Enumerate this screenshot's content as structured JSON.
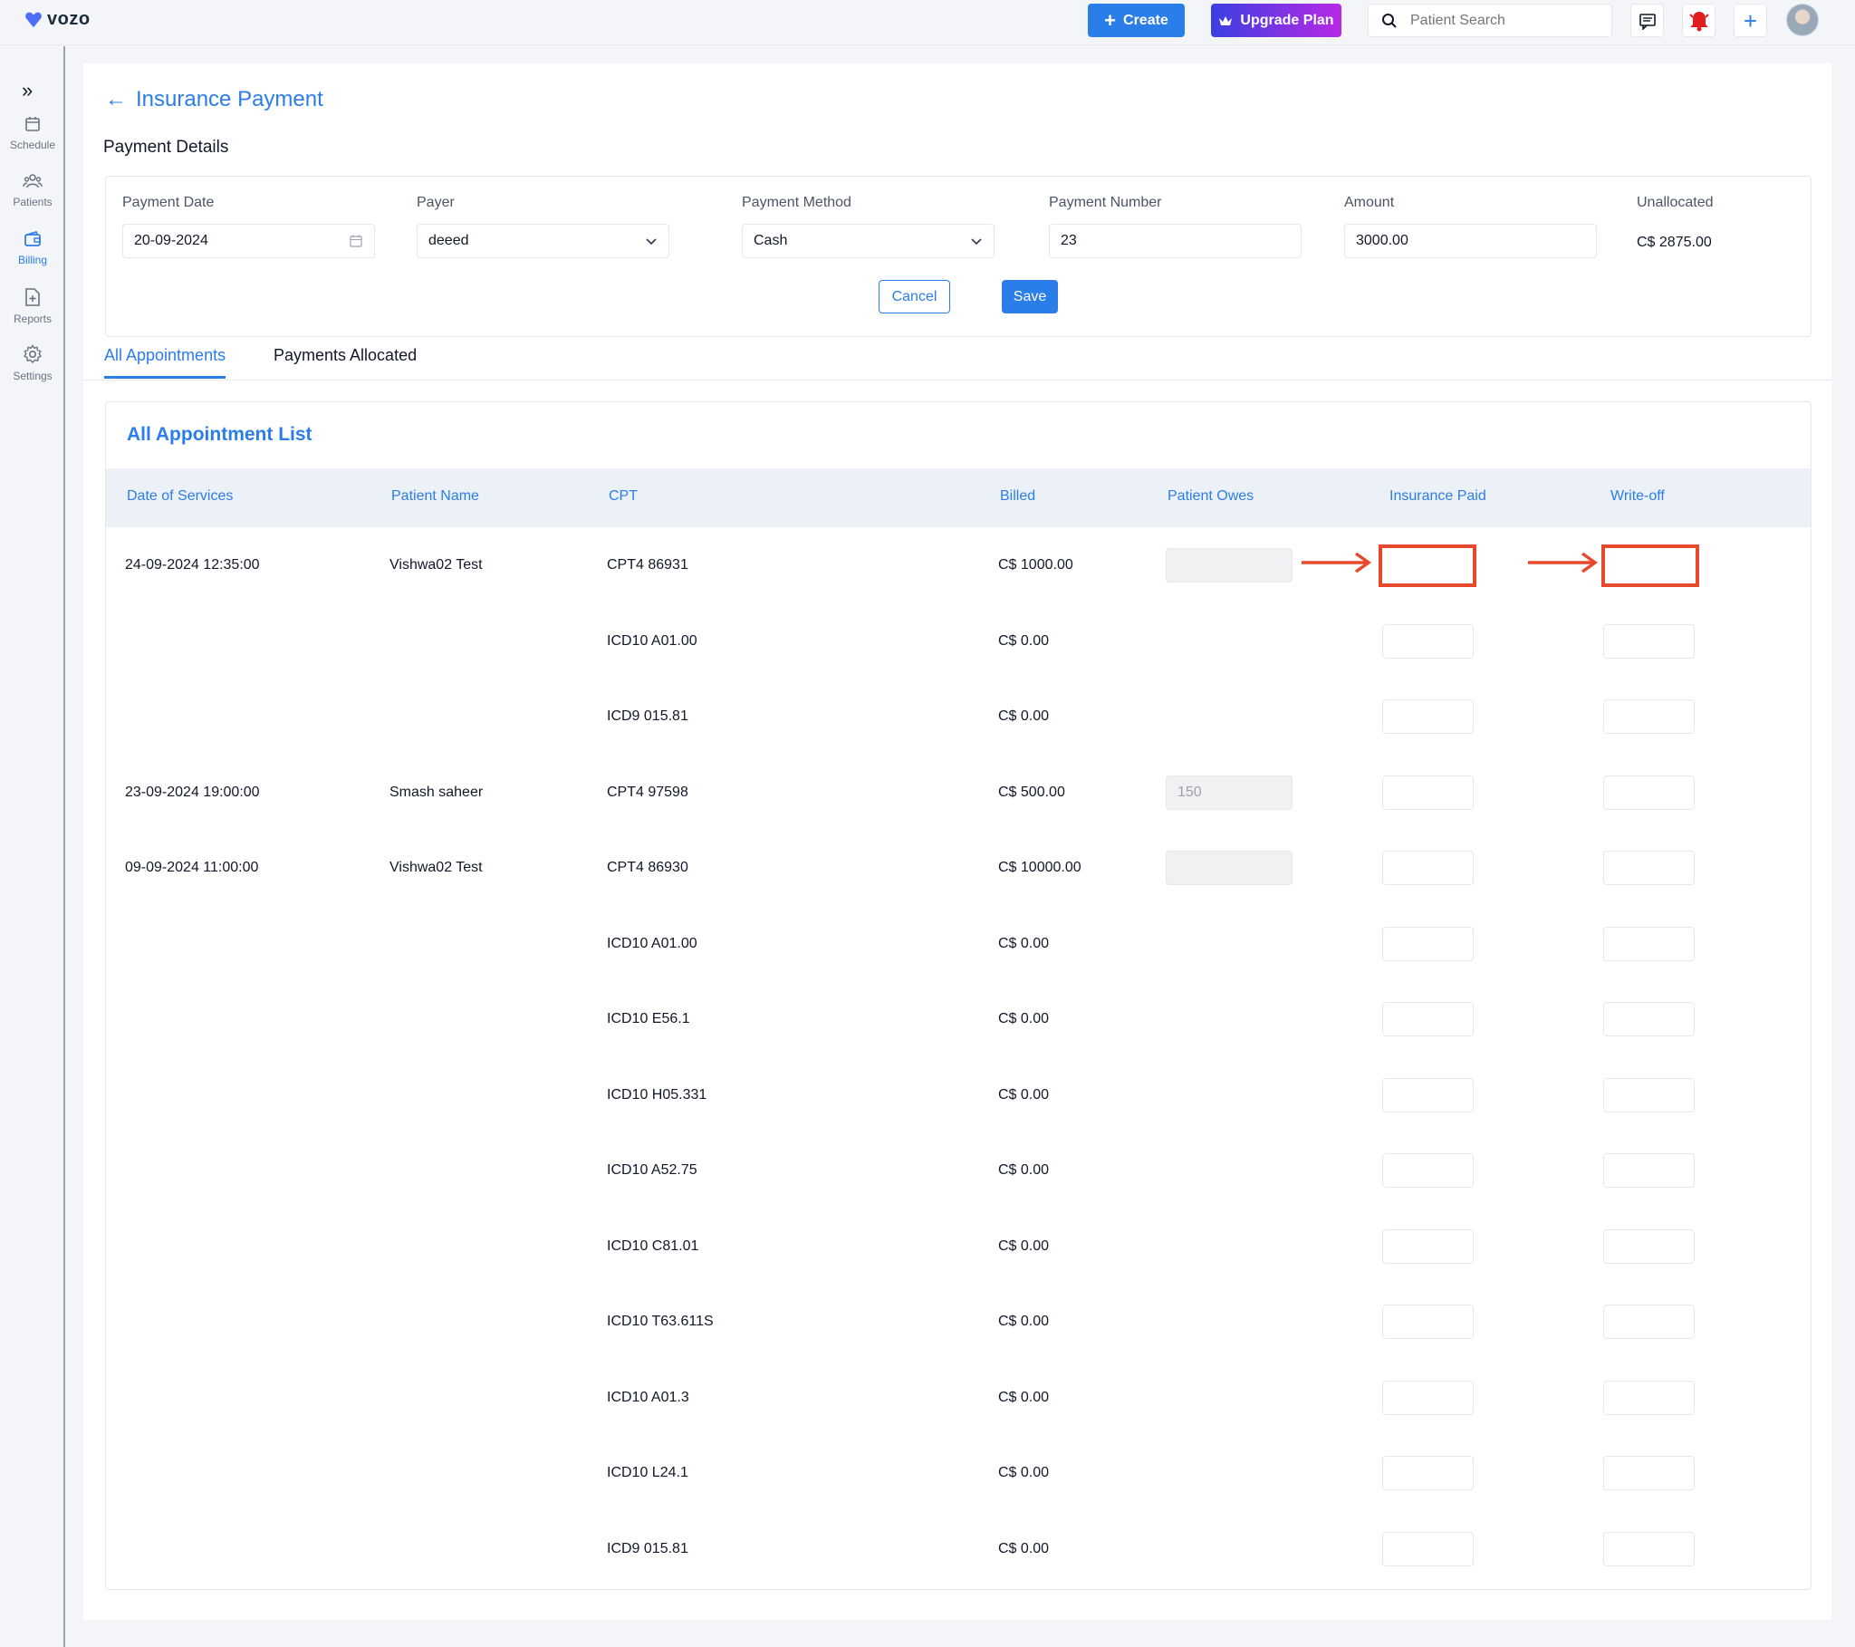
{
  "app": {
    "logo_text": "vozo"
  },
  "topbar": {
    "create_label": "Create",
    "upgrade_label": "Upgrade Plan",
    "search_placeholder": "Patient Search",
    "icons": [
      "chat-icon",
      "bell-icon",
      "plus-icon"
    ]
  },
  "sidebar": {
    "items": [
      {
        "label": "Schedule",
        "icon": "calendar-icon",
        "active": false
      },
      {
        "label": "Patients",
        "icon": "users-icon",
        "active": false
      },
      {
        "label": "Billing",
        "icon": "wallet-icon",
        "active": true
      },
      {
        "label": "Reports",
        "icon": "report-icon",
        "active": false
      },
      {
        "label": "Settings",
        "icon": "gear-icon",
        "active": false
      }
    ]
  },
  "page": {
    "title": "Insurance Payment",
    "section_title": "Payment Details"
  },
  "payment": {
    "date_label": "Payment Date",
    "date_value": "20-09-2024",
    "payer_label": "Payer",
    "payer_value": "deeed",
    "method_label": "Payment Method",
    "method_value": "Cash",
    "number_label": "Payment Number",
    "number_value": "23",
    "amount_label": "Amount",
    "amount_value": "3000.00",
    "unallocated_label": "Unallocated",
    "unallocated_value": "C$ 2875.00",
    "cancel_label": "Cancel",
    "save_label": "Save"
  },
  "tabs": [
    {
      "label": "All Appointments",
      "active": true
    },
    {
      "label": "Payments Allocated",
      "active": false
    }
  ],
  "list": {
    "title": "All Appointment List",
    "columns": [
      "Date of Services",
      "Patient Name",
      "CPT",
      "Billed",
      "Patient Owes",
      "Insurance Paid",
      "Write-off"
    ],
    "rows": [
      {
        "date": "24-09-2024 12:35:00",
        "patient": "Vishwa02 Test",
        "cpt": "CPT4 86931",
        "billed": "C$ 1000.00",
        "owes": "",
        "show_owes": true,
        "highlight": true
      },
      {
        "date": "",
        "patient": "",
        "cpt": "ICD10 A01.00",
        "billed": "C$ 0.00",
        "owes": "",
        "show_owes": false,
        "highlight": false
      },
      {
        "date": "",
        "patient": "",
        "cpt": "ICD9 015.81",
        "billed": "C$ 0.00",
        "owes": "",
        "show_owes": false,
        "highlight": false
      },
      {
        "date": "23-09-2024 19:00:00",
        "patient": "Smash saheer",
        "cpt": "CPT4 97598",
        "billed": "C$ 500.00",
        "owes": "150",
        "show_owes": true,
        "highlight": false
      },
      {
        "date": "09-09-2024 11:00:00",
        "patient": "Vishwa02 Test",
        "cpt": "CPT4 86930",
        "billed": "C$ 10000.00",
        "owes": "",
        "show_owes": true,
        "highlight": false
      },
      {
        "date": "",
        "patient": "",
        "cpt": "ICD10 A01.00",
        "billed": "C$ 0.00",
        "owes": "",
        "show_owes": false,
        "highlight": false
      },
      {
        "date": "",
        "patient": "",
        "cpt": "ICD10 E56.1",
        "billed": "C$ 0.00",
        "owes": "",
        "show_owes": false,
        "highlight": false
      },
      {
        "date": "",
        "patient": "",
        "cpt": "ICD10 H05.331",
        "billed": "C$ 0.00",
        "owes": "",
        "show_owes": false,
        "highlight": false
      },
      {
        "date": "",
        "patient": "",
        "cpt": "ICD10 A52.75",
        "billed": "C$ 0.00",
        "owes": "",
        "show_owes": false,
        "highlight": false
      },
      {
        "date": "",
        "patient": "",
        "cpt": "ICD10 C81.01",
        "billed": "C$ 0.00",
        "owes": "",
        "show_owes": false,
        "highlight": false
      },
      {
        "date": "",
        "patient": "",
        "cpt": "ICD10 T63.611S",
        "billed": "C$ 0.00",
        "owes": "",
        "show_owes": false,
        "highlight": false
      },
      {
        "date": "",
        "patient": "",
        "cpt": "ICD10 A01.3",
        "billed": "C$ 0.00",
        "owes": "",
        "show_owes": false,
        "highlight": false
      },
      {
        "date": "",
        "patient": "",
        "cpt": "ICD10 L24.1",
        "billed": "C$ 0.00",
        "owes": "",
        "show_owes": false,
        "highlight": false
      },
      {
        "date": "",
        "patient": "",
        "cpt": "ICD9 015.81",
        "billed": "C$ 0.00",
        "owes": "",
        "show_owes": false,
        "highlight": false
      }
    ]
  },
  "colors": {
    "accent": "#2b7de9",
    "highlight": "#e8482b",
    "upgrade_start": "#3b3fe0",
    "upgrade_end": "#b829e6",
    "bell": "#e11d1d"
  }
}
